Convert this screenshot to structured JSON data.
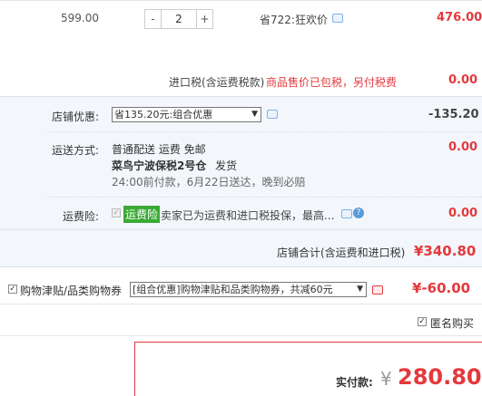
{
  "item": {
    "price": "599.00",
    "qty": "2",
    "minus": "-",
    "plus": "+",
    "promo": "省722:狂欢价",
    "subtotal": "476.00"
  },
  "tax": {
    "label": "进口税(含运费税款)",
    "note": "商品售价已包税，另付税费",
    "value": "0.00"
  },
  "store_discount": {
    "label": "店铺优惠:",
    "select": "省135.20元:组合优惠",
    "value": "-135.20"
  },
  "shipping": {
    "label": "运送方式:",
    "method": "普通配送 运费 免邮",
    "warehouse": "菜鸟宁波保税2号仓",
    "dispatch": "发货",
    "eta": "24:00前付款，6月22日送达，晚到必赔",
    "value": "0.00"
  },
  "freight_insurance": {
    "label": "运费险:",
    "badge": "运费险",
    "text": "卖家已为运费和进口税投保，最高...",
    "value": "0.00"
  },
  "store_total": {
    "label": "店铺合计(含运费和进口税)",
    "value": "¥340.80"
  },
  "coupon": {
    "label": "购物津贴/品类购物券",
    "select": "[组合优惠]购物津贴和品类购物券，共减60元",
    "value": "¥-60.00"
  },
  "anonymous": {
    "label": "匿名购买"
  },
  "payment": {
    "label": "实付款:",
    "currency": "¥",
    "value": "280.80"
  },
  "colors": {
    "accent": "#e4393c",
    "panel": "#f3f7fc",
    "green_badge": "#3aaa35"
  }
}
